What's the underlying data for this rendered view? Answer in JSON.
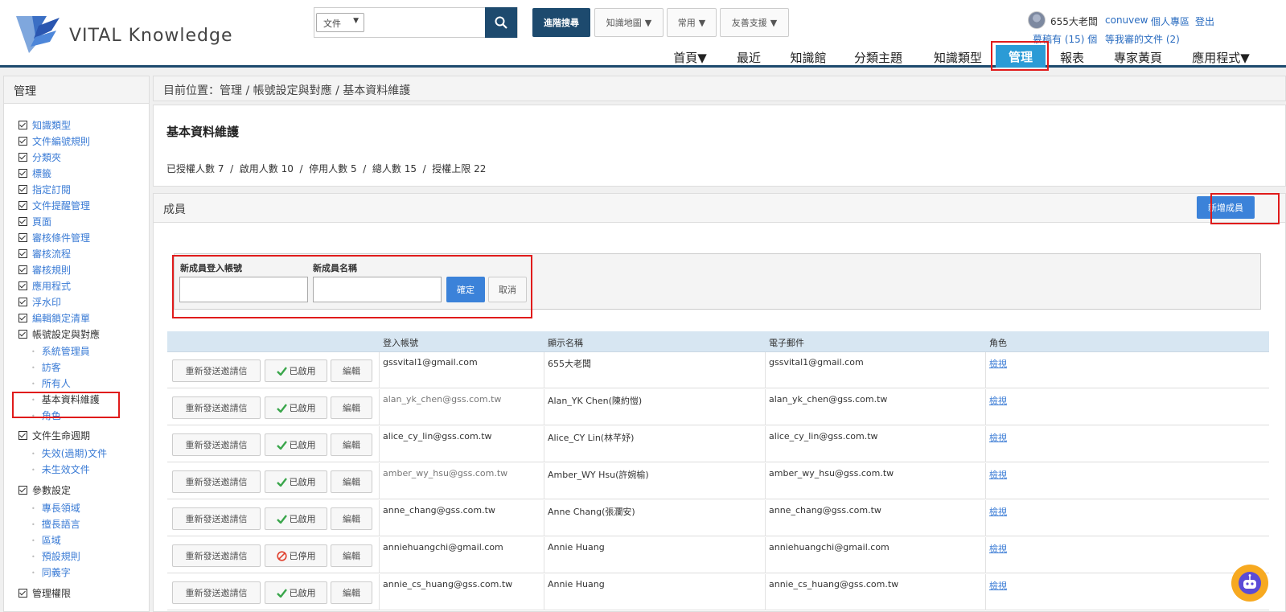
{
  "brand": {
    "name": "VITAL Knowledge"
  },
  "search": {
    "scope": "文件",
    "query": ""
  },
  "header_buttons": {
    "advanced": "進階搜尋",
    "knowledge_map": "知識地圖",
    "common": "常用",
    "friendly": "友善支援"
  },
  "user": {
    "name": "655大老闆",
    "links": [
      "conuvew",
      "個人專區",
      "登出"
    ],
    "favorites": "慕稿有 (15) 個",
    "pending_review": "等我審的文件 (2)"
  },
  "nav": [
    {
      "label": "首頁▼"
    },
    {
      "label": "最近"
    },
    {
      "label": "知識館"
    },
    {
      "label": "分類主題"
    },
    {
      "label": "知識類型"
    },
    {
      "label": "管理"
    },
    {
      "label": "報表"
    },
    {
      "label": "專家黃頁"
    },
    {
      "label": "應用程式▼"
    }
  ],
  "sidebar": {
    "title": "管理",
    "items": [
      "知識類型",
      "文件編號規則",
      "分類夾",
      "標籤",
      "指定訂閱",
      "文件提醒管理",
      "頁面",
      "審核條件管理",
      "審核流程",
      "審核規則",
      "應用程式",
      "浮水印",
      "編輯鎖定清單",
      "帳號設定與對應"
    ],
    "account_sub": [
      "系統管理員",
      "訪客",
      "所有人",
      "基本資料維護",
      "角色"
    ],
    "lifecycle": "文件生命週期",
    "lifecycle_sub": [
      "失效(過期)文件",
      "未生效文件"
    ],
    "params": "參數設定",
    "params_sub": [
      "專長領域",
      "擅長語言",
      "區域",
      "預設規則",
      "同義字"
    ],
    "permissions": "管理權限"
  },
  "breadcrumb": "目前位置：管理 / 帳號設定與對應 / 基本資料維護",
  "info": {
    "title": "基本資料維護",
    "stats": "已授權人數 7  /  啟用人數 10  /  停用人數 5  /  總人數 15  /  授權上限 22"
  },
  "members": {
    "title": "成員",
    "add_button": "新增成員",
    "form": {
      "login_label": "新成員登入帳號",
      "name_label": "新成員名稱",
      "confirm": "確定",
      "cancel": "取消"
    },
    "columns": [
      "登入帳號",
      "顯示名稱",
      "電子郵件",
      "角色"
    ],
    "actions": {
      "resend": "重新發送邀請信",
      "edit": "編輯"
    },
    "rows": [
      {
        "login": "gssvital1@gmail.com",
        "display": "655大老闆",
        "email": "gssvital1@gmail.com",
        "role": "檢視",
        "status": "已啟用",
        "active": true
      },
      {
        "login": "alan_yk_chen@gss.com.tw",
        "display": "Alan_YK Chen(陳約愷)",
        "email": "alan_yk_chen@gss.com.tw",
        "role": "檢視",
        "status": "已啟用",
        "active": true
      },
      {
        "login": "alice_cy_lin@gss.com.tw",
        "display": "Alice_CY Lin(林芊妤)",
        "email": "alice_cy_lin@gss.com.tw",
        "role": "檢視",
        "status": "已啟用",
        "active": true
      },
      {
        "login": "amber_wy_hsu@gss.com.tw",
        "display": "Amber_WY Hsu(許婉榆)",
        "email": "amber_wy_hsu@gss.com.tw",
        "role": "檢視",
        "status": "已啟用",
        "active": true
      },
      {
        "login": "anne_chang@gss.com.tw",
        "display": "Anne Chang(張瀾安)",
        "email": "anne_chang@gss.com.tw",
        "role": "檢視",
        "status": "已啟用",
        "active": true
      },
      {
        "login": "anniehuangchi@gmail.com",
        "display": "Annie Huang",
        "email": "anniehuangchi@gmail.com",
        "role": "檢視",
        "status": "已停用",
        "active": false
      },
      {
        "login": "annie_cs_huang@gss.com.tw",
        "display": "Annie Huang",
        "email": "annie_cs_huang@gss.com.tw",
        "role": "檢視",
        "status": "已啟用",
        "active": true
      }
    ]
  }
}
